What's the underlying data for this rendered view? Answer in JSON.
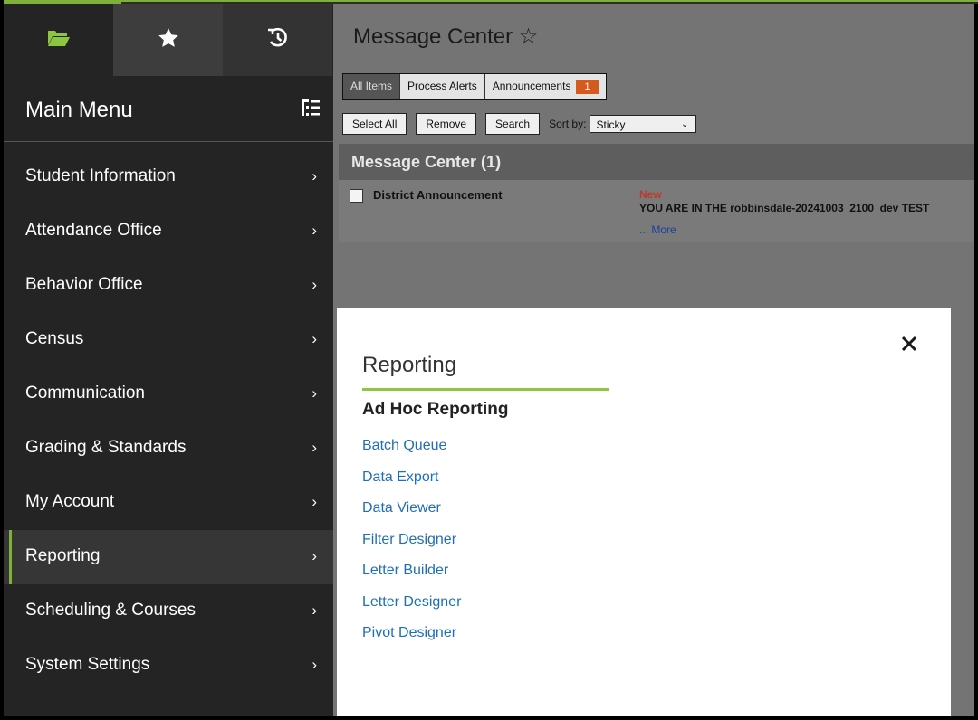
{
  "sidebar": {
    "tabs": [
      {
        "icon": "folder-icon"
      },
      {
        "icon": "star-icon"
      },
      {
        "icon": "history-icon"
      }
    ],
    "title": "Main Menu",
    "toggle_icon": "list-toggle-icon",
    "items": [
      {
        "label": "Student Information",
        "active": false
      },
      {
        "label": "Attendance Office",
        "active": false
      },
      {
        "label": "Behavior Office",
        "active": false
      },
      {
        "label": "Census",
        "active": false
      },
      {
        "label": "Communication",
        "active": false
      },
      {
        "label": "Grading & Standards",
        "active": false
      },
      {
        "label": "My Account",
        "active": false
      },
      {
        "label": "Reporting",
        "active": true
      },
      {
        "label": "Scheduling & Courses",
        "active": false
      },
      {
        "label": "System Settings",
        "active": false
      }
    ],
    "chevron": "›"
  },
  "main": {
    "title": "Message Center ☆",
    "tabs": {
      "all_items": "All Items",
      "process_alerts": "Process Alerts",
      "announcements": "Announcements",
      "announcements_count": "1"
    },
    "buttons": {
      "select_all": "Select All",
      "remove": "Remove",
      "search": "Search"
    },
    "sort_label": "Sort by:",
    "sort_value": "Sticky",
    "section_header": "Message Center (1)",
    "message": {
      "title": "District Announcement",
      "status": "New",
      "text": "YOU ARE IN THE robbinsdale-20241003_2100_dev TEST",
      "more": "... More"
    }
  },
  "panel": {
    "title": "Reporting",
    "subtitle": "Ad Hoc Reporting",
    "links": [
      "Batch Queue",
      "Data Export",
      "Data Viewer",
      "Filter Designer",
      "Letter Builder",
      "Letter Designer",
      "Pivot Designer"
    ]
  },
  "colors": {
    "accent_green": "#8dc63f",
    "sidebar_bg": "#242424",
    "link_blue": "#1f6fb5",
    "badge_orange": "#d45a1e",
    "new_red": "#c0392b"
  }
}
